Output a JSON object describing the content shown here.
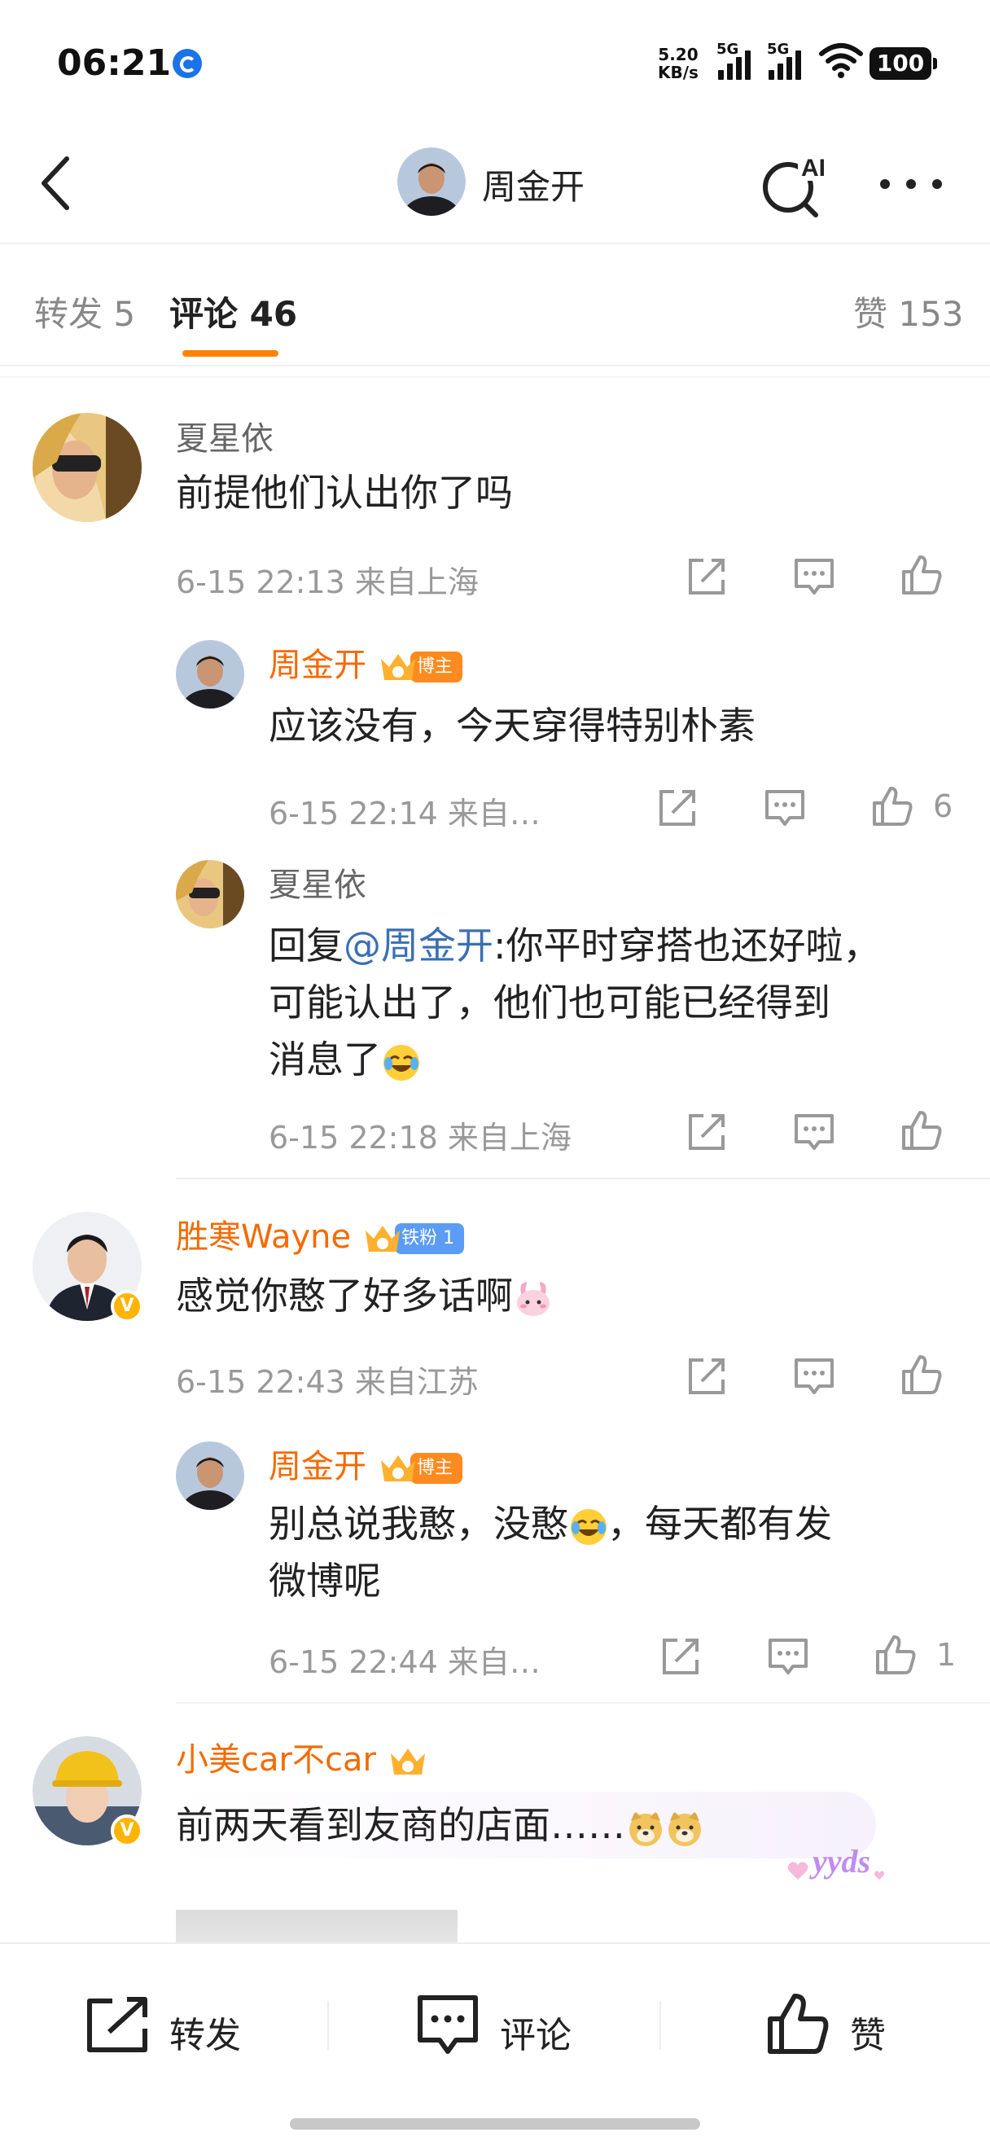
{
  "status_bar": {
    "time": "06:21",
    "net_speed_value": "5.20",
    "net_speed_unit": "KB/s",
    "signal1": "5G",
    "signal2": "5G",
    "battery": "100"
  },
  "nav": {
    "title": "周金开"
  },
  "tabs": {
    "repost": "转发 5",
    "comments": "评论 46",
    "likes": "赞 153"
  },
  "comments": [
    {
      "name": "夏星依",
      "text": "前提他们认出你了吗",
      "meta": "6-15 22:13  来自上海",
      "replies": [
        {
          "name": "周金开",
          "badge": "博主",
          "text": "应该没有，今天穿得特别朴素",
          "meta": "6-15 22:14  来自…",
          "likes": "6"
        },
        {
          "name": "夏星依",
          "text_prefix": "回复",
          "mention": "@周金开",
          "text_line1": ":你平时穿搭也还好啦，",
          "text_line2": "可能认出了，他们也可能已经得到",
          "text_line3": "消息了",
          "meta": "6-15 22:18  来自上海"
        }
      ]
    },
    {
      "name": "胜寒Wayne",
      "badge": "铁粉 1",
      "text": "感觉你憨了好多话啊",
      "meta": "6-15 22:43  来自江苏",
      "replies": [
        {
          "name": "周金开",
          "badge": "博主",
          "text_line1a": "别总说我憨，没憨",
          "text_line1b": "，每天都有发",
          "text_line2": "微博呢",
          "meta": "6-15 22:44  来自…",
          "likes": "1"
        }
      ]
    },
    {
      "name": "小美car不car",
      "text": "前两天看到友商的店面……",
      "sticker": "yyds"
    }
  ],
  "bottom_bar": {
    "repost": "转发",
    "comment": "评论",
    "like": "赞"
  },
  "colors": {
    "accent": "#ff8200",
    "name_orange": "#f56a00",
    "mention_blue": "#3b6fb3",
    "meta_gray": "#999999"
  }
}
